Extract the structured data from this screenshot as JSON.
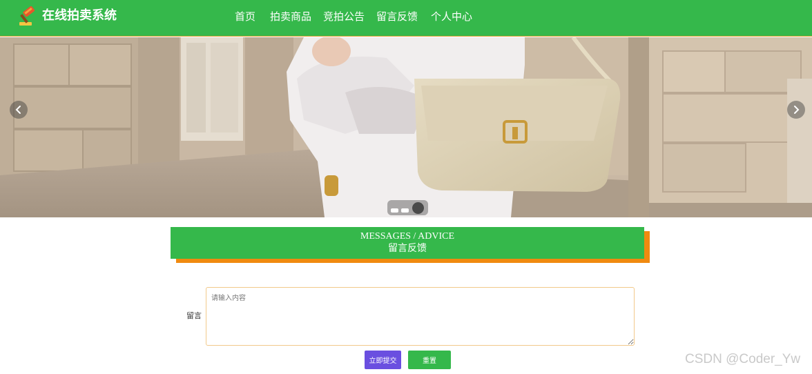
{
  "header": {
    "brand": "在线拍卖系统",
    "logo_icon": "gavel-icon",
    "background": "#35b84b",
    "nav": [
      {
        "label": "首页"
      },
      {
        "label": "拍卖商品"
      },
      {
        "label": "竞拍公告"
      },
      {
        "label": "留言反馈"
      },
      {
        "label": "个人中心"
      }
    ]
  },
  "carousel": {
    "prev_icon": "chevron-left-icon",
    "next_icon": "chevron-right-icon",
    "slide_count": 3,
    "active_slide": 3
  },
  "section": {
    "title_en": "MESSAGES / ADVICE",
    "title_cn": "留言反馈",
    "accent": "#f08a10"
  },
  "form": {
    "label": "留言",
    "placeholder": "请输入内容",
    "value": "",
    "submit_label": "立即提交",
    "reset_label": "重置"
  },
  "watermark": "CSDN @Coder_Yw"
}
